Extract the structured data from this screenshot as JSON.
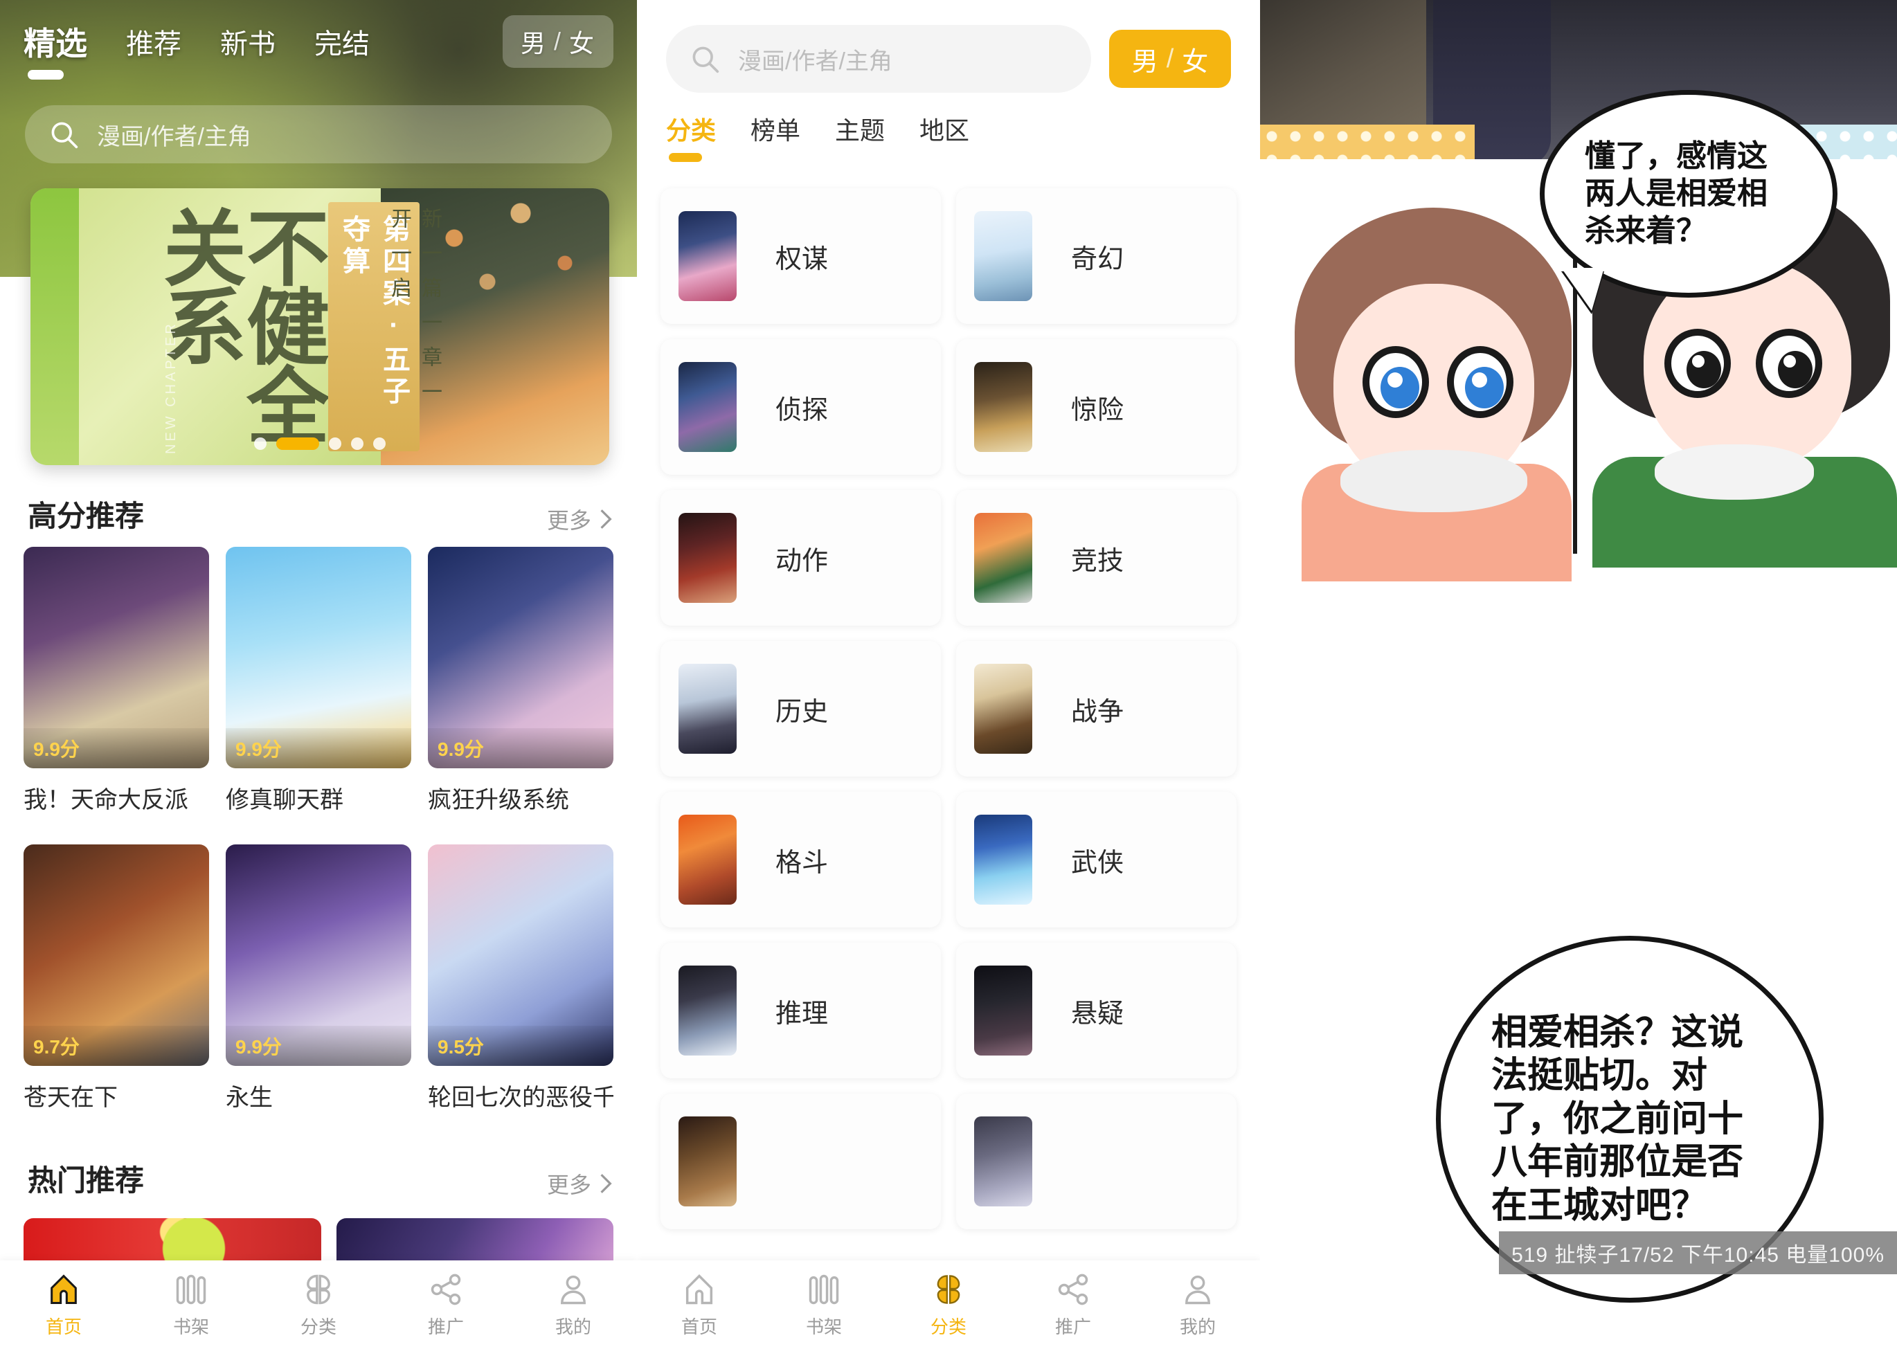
{
  "home": {
    "tabs": [
      {
        "label": "精选",
        "active": true
      },
      {
        "label": "推荐",
        "active": false
      },
      {
        "label": "新书",
        "active": false
      },
      {
        "label": "完结",
        "active": false
      }
    ],
    "gender_toggle": {
      "male": "男",
      "slash": "/",
      "female": "女"
    },
    "search": {
      "placeholder": "漫画/作者/主角",
      "icon": "search-icon"
    },
    "banner": {
      "title": "不健全关系",
      "tagline": "第四案·五子夺算",
      "subline": "新一篇一章一开一启",
      "new_chapter": "NEW CHAPTER",
      "dots_total": 5,
      "dots_active_index": 1
    },
    "sections": [
      {
        "title": "高分推荐",
        "more": "更多",
        "books": [
          {
            "name": "我！天命大反派",
            "score": "9.9分"
          },
          {
            "name": "修真聊天群",
            "score": "9.9分"
          },
          {
            "name": "疯狂升级系统",
            "score": "9.9分"
          },
          {
            "name": "苍天在下",
            "score": "9.7分"
          },
          {
            "name": "永生",
            "score": "9.9分"
          },
          {
            "name": "轮回七次的恶役千",
            "score": "9.5分"
          }
        ]
      },
      {
        "title": "热门推荐",
        "more": "更多",
        "books": []
      }
    ]
  },
  "category": {
    "search": {
      "placeholder": "漫画/作者/主角",
      "icon": "search-icon"
    },
    "gender_toggle": {
      "male": "男",
      "slash": "/",
      "female": "女"
    },
    "tabs": [
      {
        "label": "分类",
        "active": true
      },
      {
        "label": "榜单",
        "active": false
      },
      {
        "label": "主题",
        "active": false
      },
      {
        "label": "地区",
        "active": false
      }
    ],
    "items": [
      {
        "label": "权谋"
      },
      {
        "label": "奇幻"
      },
      {
        "label": "侦探"
      },
      {
        "label": "惊险"
      },
      {
        "label": "动作"
      },
      {
        "label": "竞技"
      },
      {
        "label": "历史"
      },
      {
        "label": "战争"
      },
      {
        "label": "格斗"
      },
      {
        "label": "武侠"
      },
      {
        "label": "推理"
      },
      {
        "label": "悬疑"
      },
      {
        "label": ""
      },
      {
        "label": ""
      }
    ]
  },
  "reader": {
    "bubbles": [
      {
        "text": "懂了，感情这两人是相爱相杀来着？"
      },
      {
        "text": "相爱相杀？这说法挺贴切。对了，你之前问十八年前那位是否在王城对吧？"
      }
    ],
    "statusbar": "519 扯犊子17/52 下午10:45 电量100%"
  },
  "tabbar": {
    "items": [
      {
        "label": "首页",
        "icon": "home-icon"
      },
      {
        "label": "书架",
        "icon": "bookshelf-icon"
      },
      {
        "label": "分类",
        "icon": "grid-icon"
      },
      {
        "label": "推广",
        "icon": "share-icon"
      },
      {
        "label": "我的",
        "icon": "user-icon"
      }
    ],
    "home_active_index": 0,
    "category_active_index": 2
  },
  "colors": {
    "accent": "#f5b511",
    "score": "#ffd34d",
    "muted": "#9b9b9b"
  }
}
